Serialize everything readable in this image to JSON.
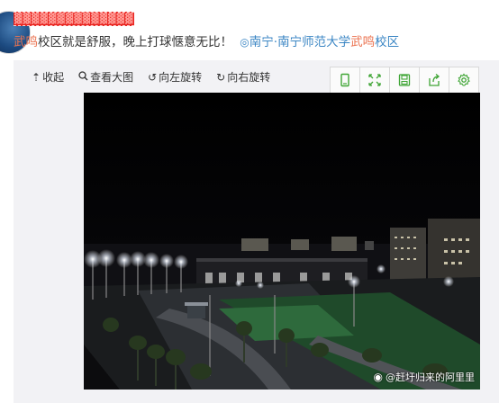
{
  "post": {
    "author": "▓▓▓▓▓▓▓▓▓▓▓▓▓▓",
    "tag": "武鸣",
    "text": "校区就是舒服，晚上打球惬意无比！",
    "location_prefix": "南宁·南宁师范大学",
    "location_highlight": "武鸣",
    "location_suffix": "校区"
  },
  "toolbar": {
    "collapse": "收起",
    "view_large": "查看大图",
    "rotate_left": "向左旋转",
    "rotate_right": "向右旋转"
  },
  "photo": {
    "watermark": "@赶圩归来的阿里里"
  },
  "colors": {
    "accent": "#eb7350",
    "location": "#3b86c4",
    "icon_green": "#3fa535",
    "redaction": "#e8231f"
  }
}
